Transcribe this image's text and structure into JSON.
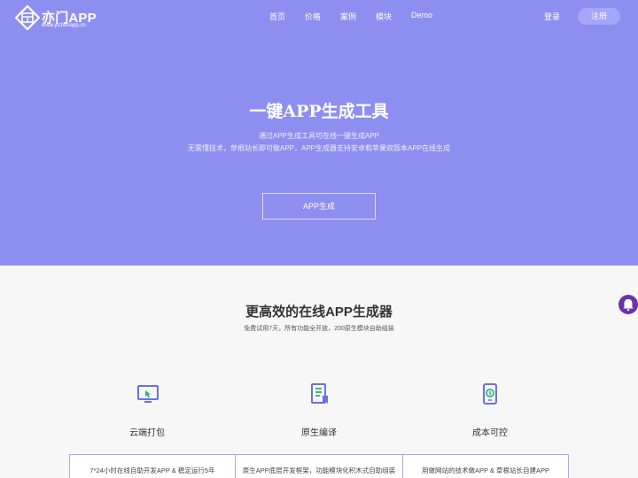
{
  "brand": {
    "title": "亦门APP",
    "subtitle": "www.yizhenapp.cn"
  },
  "nav": {
    "items": [
      "首页",
      "价格",
      "案例",
      "模块",
      "Demo"
    ],
    "login": "登录",
    "signup": "注册"
  },
  "hero": {
    "title": "一键APP生成工具",
    "line1": "通过APP生成工具可在线一键生成APP",
    "line2": "无需懂技术，草根站长即可做APP，APP生成器支持安卓和苹果双版本APP在线生成",
    "button": "APP生成"
  },
  "section": {
    "title": "更高效的在线APP生成器",
    "subtitle": "免费试用7天，所有功能全开放，200原生模块自助组装"
  },
  "features": [
    {
      "icon": "cloud-package-icon",
      "label": "云端打包",
      "desc": "7*24小时在线自助开发APP & 稳定运行5年"
    },
    {
      "icon": "native-compile-icon",
      "label": "原生编译",
      "desc": "原生APP底层开发框架，功能模块化积木式自助组装"
    },
    {
      "icon": "cost-control-icon",
      "label": "成本可控",
      "desc": "用做网站的技术做APP & 草根站长自建APP"
    }
  ],
  "colors": {
    "hero_bg": "#8d8ff0",
    "accent": "#6c6fe8",
    "chat": "#6e33a8"
  }
}
